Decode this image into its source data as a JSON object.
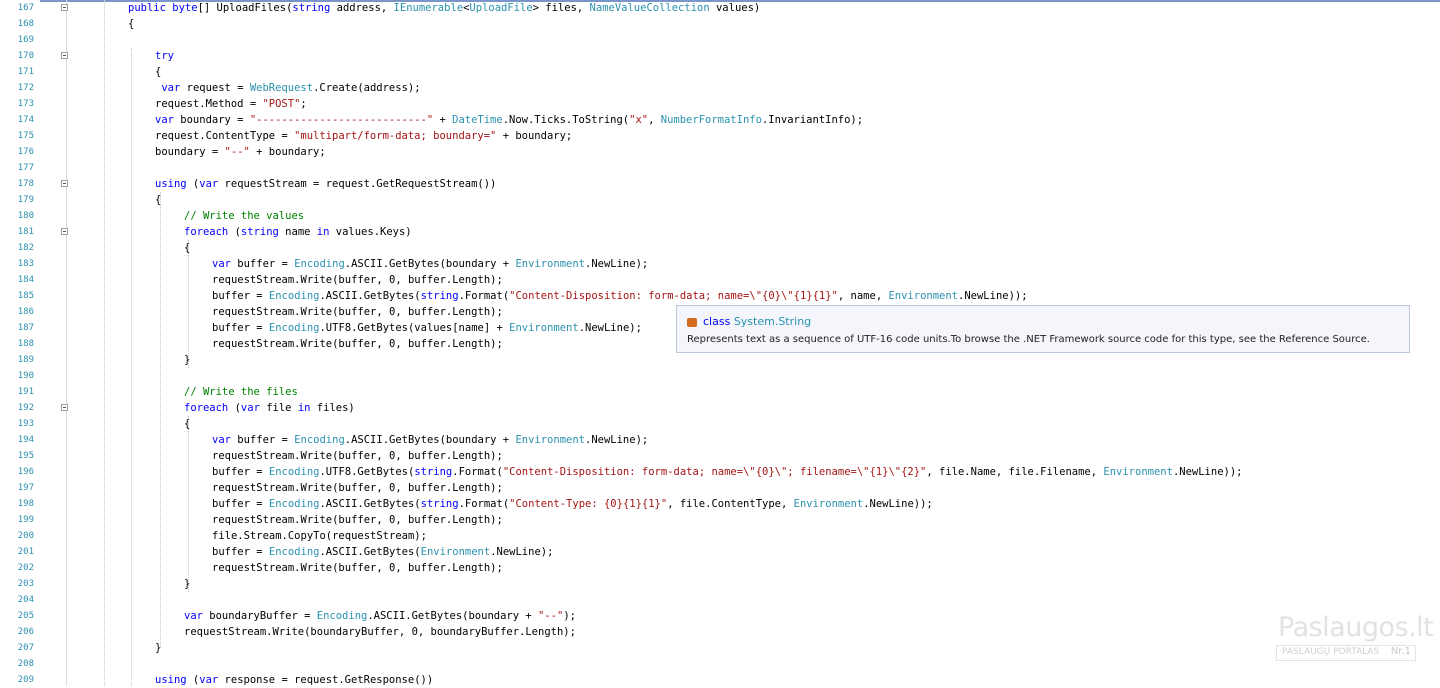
{
  "editor": {
    "lines": [
      {
        "n": "167",
        "fold": true,
        "indent": 0,
        "segs": [
          [
            "kw",
            "public "
          ],
          [
            "kw",
            "byte"
          ],
          [
            "tx",
            "[] UploadFiles("
          ],
          [
            "kw",
            "string"
          ],
          [
            "tx",
            " address, "
          ],
          [
            "ty",
            "IEnumerable"
          ],
          [
            "tx",
            "<"
          ],
          [
            "ty",
            "UploadFile"
          ],
          [
            "tx",
            "> files, "
          ],
          [
            "ty",
            "NameValueCollection"
          ],
          [
            "tx",
            " values)"
          ]
        ]
      },
      {
        "n": "168",
        "fold": false,
        "indent": 0,
        "segs": [
          [
            "tx",
            "{"
          ]
        ]
      },
      {
        "n": "169",
        "fold": false,
        "indent": 0,
        "segs": []
      },
      {
        "n": "170",
        "fold": true,
        "indent": 1,
        "segs": [
          [
            "kw",
            "try"
          ]
        ]
      },
      {
        "n": "171",
        "fold": false,
        "indent": 1,
        "segs": [
          [
            "tx",
            "{"
          ]
        ]
      },
      {
        "n": "172",
        "fold": false,
        "indent": 1,
        "segs": [
          [
            "kw",
            " var"
          ],
          [
            "tx",
            " request = "
          ],
          [
            "ty",
            "WebRequest"
          ],
          [
            "tx",
            ".Create(address);"
          ]
        ]
      },
      {
        "n": "173",
        "fold": false,
        "indent": 1,
        "segs": [
          [
            "tx",
            "request.Method = "
          ],
          [
            "str",
            "\"POST\""
          ],
          [
            "tx",
            ";"
          ]
        ]
      },
      {
        "n": "174",
        "fold": false,
        "indent": 1,
        "segs": [
          [
            "kw",
            "var"
          ],
          [
            "tx",
            " boundary = "
          ],
          [
            "str",
            "\"---------------------------\""
          ],
          [
            "tx",
            " + "
          ],
          [
            "ty",
            "DateTime"
          ],
          [
            "tx",
            ".Now.Ticks.ToString("
          ],
          [
            "str",
            "\"x\""
          ],
          [
            "tx",
            ", "
          ],
          [
            "ty",
            "NumberFormatInfo"
          ],
          [
            "tx",
            ".InvariantInfo);"
          ]
        ]
      },
      {
        "n": "175",
        "fold": false,
        "indent": 1,
        "segs": [
          [
            "tx",
            "request.ContentType = "
          ],
          [
            "str",
            "\"multipart/form-data; boundary=\""
          ],
          [
            "tx",
            " + boundary;"
          ]
        ]
      },
      {
        "n": "176",
        "fold": false,
        "indent": 1,
        "segs": [
          [
            "tx",
            "boundary = "
          ],
          [
            "str",
            "\"--\""
          ],
          [
            "tx",
            " + boundary;"
          ]
        ]
      },
      {
        "n": "177",
        "fold": false,
        "indent": 1,
        "segs": []
      },
      {
        "n": "178",
        "fold": true,
        "indent": 1,
        "segs": [
          [
            "kw",
            "using"
          ],
          [
            "tx",
            " ("
          ],
          [
            "kw",
            "var"
          ],
          [
            "tx",
            " requestStream = request.GetRequestStream())"
          ]
        ]
      },
      {
        "n": "179",
        "fold": false,
        "indent": 1,
        "segs": [
          [
            "tx",
            "{"
          ]
        ]
      },
      {
        "n": "180",
        "fold": false,
        "indent": 2,
        "segs": [
          [
            "cm",
            "// Write the values"
          ]
        ]
      },
      {
        "n": "181",
        "fold": true,
        "indent": 2,
        "segs": [
          [
            "kw",
            "foreach"
          ],
          [
            "tx",
            " ("
          ],
          [
            "kw",
            "string"
          ],
          [
            "tx",
            " name "
          ],
          [
            "kw",
            "in"
          ],
          [
            "tx",
            " values.Keys)"
          ]
        ]
      },
      {
        "n": "182",
        "fold": false,
        "indent": 2,
        "segs": [
          [
            "tx",
            "{"
          ]
        ]
      },
      {
        "n": "183",
        "fold": false,
        "indent": 3,
        "segs": [
          [
            "kw",
            "var"
          ],
          [
            "tx",
            " buffer = "
          ],
          [
            "ty",
            "Encoding"
          ],
          [
            "tx",
            ".ASCII.GetBytes(boundary + "
          ],
          [
            "ty",
            "Environment"
          ],
          [
            "tx",
            ".NewLine);"
          ]
        ]
      },
      {
        "n": "184",
        "fold": false,
        "indent": 3,
        "segs": [
          [
            "tx",
            "requestStream.Write(buffer, 0, buffer.Length);"
          ]
        ]
      },
      {
        "n": "185",
        "fold": false,
        "indent": 3,
        "segs": [
          [
            "tx",
            "buffer = "
          ],
          [
            "ty",
            "Encoding"
          ],
          [
            "tx",
            ".ASCII.GetBytes("
          ],
          [
            "kw",
            "string"
          ],
          [
            "tx",
            ".Format("
          ],
          [
            "str",
            "\"Content-Disposition: form-data; name=\\\"{0}\\\"{1}{1}\""
          ],
          [
            "tx",
            ", name, "
          ],
          [
            "ty",
            "Environment"
          ],
          [
            "tx",
            ".NewLine));"
          ]
        ]
      },
      {
        "n": "186",
        "fold": false,
        "indent": 3,
        "segs": [
          [
            "tx",
            "requestStream.Write(buffer, 0, buffer.Length);"
          ]
        ]
      },
      {
        "n": "187",
        "fold": false,
        "indent": 3,
        "segs": [
          [
            "tx",
            "buffer = "
          ],
          [
            "ty",
            "Encoding"
          ],
          [
            "tx",
            ".UTF8.GetBytes(values[name] + "
          ],
          [
            "ty",
            "Environment"
          ],
          [
            "tx",
            ".NewLine);"
          ]
        ]
      },
      {
        "n": "188",
        "fold": false,
        "indent": 3,
        "segs": [
          [
            "tx",
            "requestStream.Write(buffer, 0, buffer.Length);"
          ]
        ]
      },
      {
        "n": "189",
        "fold": false,
        "indent": 2,
        "segs": [
          [
            "tx",
            "}"
          ]
        ]
      },
      {
        "n": "190",
        "fold": false,
        "indent": 2,
        "segs": []
      },
      {
        "n": "191",
        "fold": false,
        "indent": 2,
        "segs": [
          [
            "cm",
            "// Write the files"
          ]
        ]
      },
      {
        "n": "192",
        "fold": true,
        "indent": 2,
        "segs": [
          [
            "kw",
            "foreach"
          ],
          [
            "tx",
            " ("
          ],
          [
            "kw",
            "var"
          ],
          [
            "tx",
            " file "
          ],
          [
            "kw",
            "in"
          ],
          [
            "tx",
            " files)"
          ]
        ]
      },
      {
        "n": "193",
        "fold": false,
        "indent": 2,
        "segs": [
          [
            "tx",
            "{"
          ]
        ]
      },
      {
        "n": "194",
        "fold": false,
        "indent": 3,
        "segs": [
          [
            "kw",
            "var"
          ],
          [
            "tx",
            " buffer = "
          ],
          [
            "ty",
            "Encoding"
          ],
          [
            "tx",
            ".ASCII.GetBytes(boundary + "
          ],
          [
            "ty",
            "Environment"
          ],
          [
            "tx",
            ".NewLine);"
          ]
        ]
      },
      {
        "n": "195",
        "fold": false,
        "indent": 3,
        "segs": [
          [
            "tx",
            "requestStream.Write(buffer, 0, buffer.Length);"
          ]
        ]
      },
      {
        "n": "196",
        "fold": false,
        "indent": 3,
        "segs": [
          [
            "tx",
            "buffer = "
          ],
          [
            "ty",
            "Encoding"
          ],
          [
            "tx",
            ".UTF8.GetBytes("
          ],
          [
            "kw",
            "string"
          ],
          [
            "tx",
            ".Format("
          ],
          [
            "str",
            "\"Content-Disposition: form-data; name=\\\"{0}\\\"; filename=\\\"{1}\\\"{2}\""
          ],
          [
            "tx",
            ", file.Name, file.Filename, "
          ],
          [
            "ty",
            "Environment"
          ],
          [
            "tx",
            ".NewLine));"
          ]
        ]
      },
      {
        "n": "197",
        "fold": false,
        "indent": 3,
        "segs": [
          [
            "tx",
            "requestStream.Write(buffer, 0, buffer.Length);"
          ]
        ]
      },
      {
        "n": "198",
        "fold": false,
        "indent": 3,
        "segs": [
          [
            "tx",
            "buffer = "
          ],
          [
            "ty",
            "Encoding"
          ],
          [
            "tx",
            ".ASCII.GetBytes("
          ],
          [
            "kw",
            "string"
          ],
          [
            "tx",
            ".Format("
          ],
          [
            "str",
            "\"Content-Type: {0}{1}{1}\""
          ],
          [
            "tx",
            ", file.ContentType, "
          ],
          [
            "ty",
            "Environment"
          ],
          [
            "tx",
            ".NewLine));"
          ]
        ]
      },
      {
        "n": "199",
        "fold": false,
        "indent": 3,
        "segs": [
          [
            "tx",
            "requestStream.Write(buffer, 0, buffer.Length);"
          ]
        ]
      },
      {
        "n": "200",
        "fold": false,
        "indent": 3,
        "segs": [
          [
            "tx",
            "file.Stream.CopyTo(requestStream);"
          ]
        ]
      },
      {
        "n": "201",
        "fold": false,
        "indent": 3,
        "segs": [
          [
            "tx",
            "buffer = "
          ],
          [
            "ty",
            "Encoding"
          ],
          [
            "tx",
            ".ASCII.GetBytes("
          ],
          [
            "ty",
            "Environment"
          ],
          [
            "tx",
            ".NewLine);"
          ]
        ]
      },
      {
        "n": "202",
        "fold": false,
        "indent": 3,
        "segs": [
          [
            "tx",
            "requestStream.Write(buffer, 0, buffer.Length);"
          ]
        ]
      },
      {
        "n": "203",
        "fold": false,
        "indent": 2,
        "segs": [
          [
            "tx",
            "}"
          ]
        ]
      },
      {
        "n": "204",
        "fold": false,
        "indent": 2,
        "segs": []
      },
      {
        "n": "205",
        "fold": false,
        "indent": 2,
        "segs": [
          [
            "kw",
            "var"
          ],
          [
            "tx",
            " boundaryBuffer = "
          ],
          [
            "ty",
            "Encoding"
          ],
          [
            "tx",
            ".ASCII.GetBytes(boundary + "
          ],
          [
            "str",
            "\"--\""
          ],
          [
            "tx",
            ");"
          ]
        ]
      },
      {
        "n": "206",
        "fold": false,
        "indent": 2,
        "segs": [
          [
            "tx",
            "requestStream.Write(boundaryBuffer, 0, boundaryBuffer.Length);"
          ]
        ]
      },
      {
        "n": "207",
        "fold": false,
        "indent": 1,
        "segs": [
          [
            "tx",
            "}"
          ]
        ]
      },
      {
        "n": "208",
        "fold": false,
        "indent": 1,
        "segs": []
      },
      {
        "n": "209",
        "fold": false,
        "indent": 1,
        "segs": [
          [
            "kw",
            "using"
          ],
          [
            "tx",
            " ("
          ],
          [
            "kw",
            "var"
          ],
          [
            "tx",
            " response = request.GetResponse())"
          ]
        ]
      }
    ]
  },
  "tooltip": {
    "kind": "class",
    "type_name": "System.String",
    "description": "Represents text as a sequence of UTF-16 code units.To browse the .NET Framework source code for this type, see the Reference Source."
  },
  "watermark": {
    "logo": "Paslaugos.lt",
    "tagline": "PASLAUGŲ PORTALAS",
    "rank": "Nr.1"
  },
  "colors": {
    "keyword": "#0000ff",
    "type": "#2b91af",
    "string": "#a31515",
    "comment": "#008000",
    "line_number": "#2b91af"
  }
}
